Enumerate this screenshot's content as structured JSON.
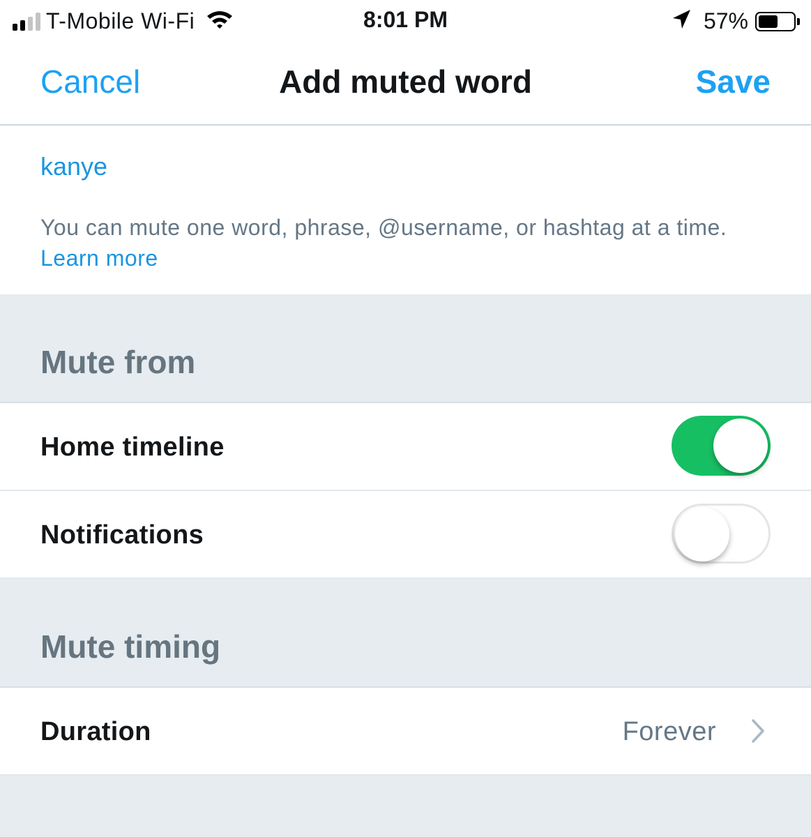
{
  "status_bar": {
    "carrier": "T-Mobile Wi-Fi",
    "time": "8:01 PM",
    "battery": "57%",
    "signal_bars_filled": 2,
    "signal_bars_total": 4,
    "battery_level": 0.57,
    "icons": [
      "signal-icon",
      "wifi-icon",
      "location-arrow-icon",
      "battery-icon"
    ]
  },
  "nav": {
    "cancel_label": "Cancel",
    "title": "Add muted word",
    "save_label": "Save"
  },
  "word": {
    "value": "kanye",
    "help_text": "You can mute one word, phrase, @username, or hashtag at a time.",
    "learn_more": "Learn more"
  },
  "mute_from": {
    "header": "Mute from",
    "home_timeline": {
      "label": "Home timeline",
      "enabled": true
    },
    "notifications": {
      "label": "Notifications",
      "enabled": false
    }
  },
  "mute_timing": {
    "header": "Mute timing",
    "duration": {
      "label": "Duration",
      "value": "Forever"
    }
  },
  "colors": {
    "accent": "#1da1f2",
    "toggle_on": "#17bf63",
    "section_bg": "#e6ecf0"
  }
}
